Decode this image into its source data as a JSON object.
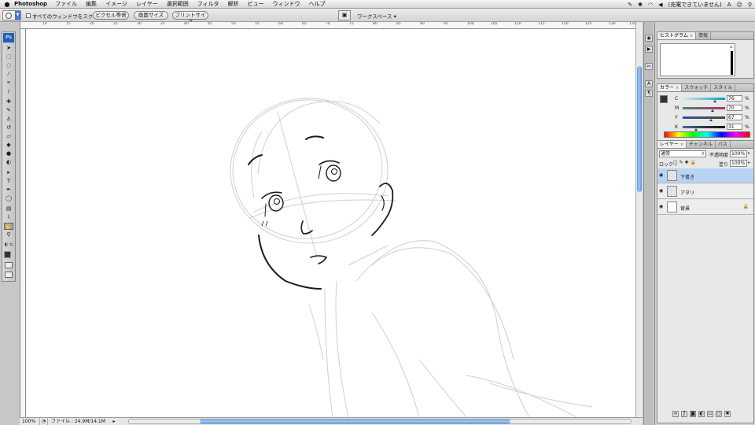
{
  "menubar": {
    "apple": "",
    "app_name": "Photoshop",
    "items": [
      "ファイル",
      "編集",
      "イメージ",
      "レイヤー",
      "選択範囲",
      "フィルタ",
      "解析",
      "ビュー",
      "ウィンドウ",
      "ヘルプ"
    ],
    "status_text": "(充電できていません)"
  },
  "options_bar": {
    "scroll_all_windows": "すべてのウィンドウをスクロール",
    "actual_pixels": "ピクセル等倍",
    "fit_screen": "画面サイズ",
    "print_size": "プリントサイズ",
    "workspace": "ワークスペース ▾"
  },
  "toolbox": {
    "logo": "Ps"
  },
  "ruler": {
    "ticks": [
      "10",
      "15",
      "20",
      "25",
      "30",
      "35",
      "40",
      "45",
      "50",
      "55",
      "60",
      "65",
      "70",
      "75",
      "80",
      "85",
      "90",
      "95",
      "100",
      "105",
      "110",
      "115",
      "120",
      "125",
      "130",
      "135"
    ]
  },
  "status": {
    "zoom": "100%",
    "file_info": "ファイル : 24.9M/14.1M"
  },
  "panels": {
    "histogram_tabs": [
      "ヒストグラム",
      "情報"
    ],
    "color_tabs": [
      "カラー",
      "スウォッチ",
      "スタイル"
    ],
    "cmyk": [
      {
        "label": "C",
        "value": "76",
        "pct": "%",
        "pos": 0.76
      },
      {
        "label": "M",
        "value": "70",
        "pct": "%",
        "pos": 0.7
      },
      {
        "label": "Y",
        "value": "67",
        "pct": "%",
        "pos": 0.67
      },
      {
        "label": "K",
        "value": "31",
        "pct": "%",
        "pos": 0.31
      }
    ],
    "layers_tabs": [
      "レイヤー",
      "チャンネル",
      "パス"
    ],
    "blend_mode": "通常",
    "opacity_label": "不透明度 :",
    "opacity": "100%",
    "lock_label": "ロック :",
    "fill_label": "塗り :",
    "fill": "100%",
    "layers": [
      {
        "name": "下書き",
        "selected": true
      },
      {
        "name": "アタリ",
        "selected": false
      },
      {
        "name": "背景",
        "selected": false
      }
    ]
  }
}
